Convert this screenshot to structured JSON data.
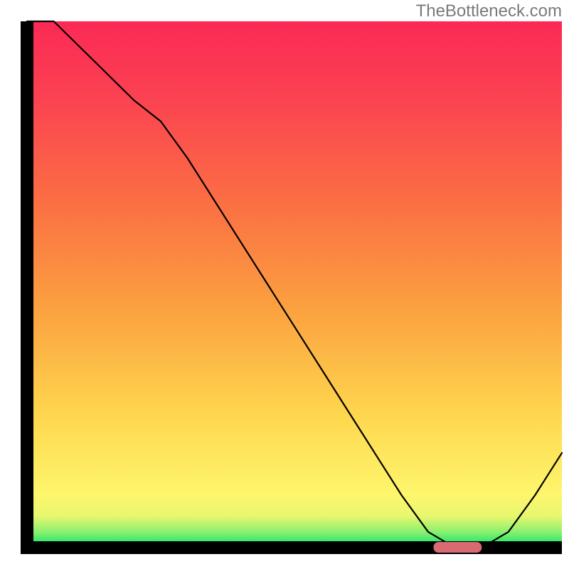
{
  "watermark": "TheBottleneck.com",
  "chart_data": {
    "type": "line",
    "title": "",
    "xlabel": "",
    "ylabel": "",
    "xlim": [
      0,
      100
    ],
    "ylim": [
      0,
      100
    ],
    "series": [
      {
        "name": "bottleneck-curve",
        "x": [
          0,
          5,
          10,
          15,
          20,
          25,
          30,
          35,
          40,
          45,
          50,
          55,
          60,
          65,
          70,
          75,
          80,
          85,
          90,
          95,
          100
        ],
        "y": [
          100,
          100,
          95,
          90,
          85,
          81,
          74,
          66,
          58,
          50,
          42,
          34,
          26,
          18,
          10,
          3,
          0,
          0,
          3,
          10,
          18
        ]
      }
    ],
    "marker": {
      "name": "optimal-range-marker",
      "x_start": 76,
      "x_end": 85,
      "y": 0,
      "color": "#d96a74"
    },
    "gradient_stops": [
      {
        "offset": 0.0,
        "color": "#00e36c"
      },
      {
        "offset": 0.03,
        "color": "#8bf06f"
      },
      {
        "offset": 0.06,
        "color": "#e8f76e"
      },
      {
        "offset": 0.1,
        "color": "#fef66d"
      },
      {
        "offset": 0.25,
        "color": "#fed74e"
      },
      {
        "offset": 0.45,
        "color": "#fba240"
      },
      {
        "offset": 0.65,
        "color": "#fb7043"
      },
      {
        "offset": 0.85,
        "color": "#fb4351"
      },
      {
        "offset": 1.0,
        "color": "#fb2955"
      }
    ],
    "axis_color": "#000000",
    "curve_color": "#000000",
    "curve_width": 2.2
  }
}
